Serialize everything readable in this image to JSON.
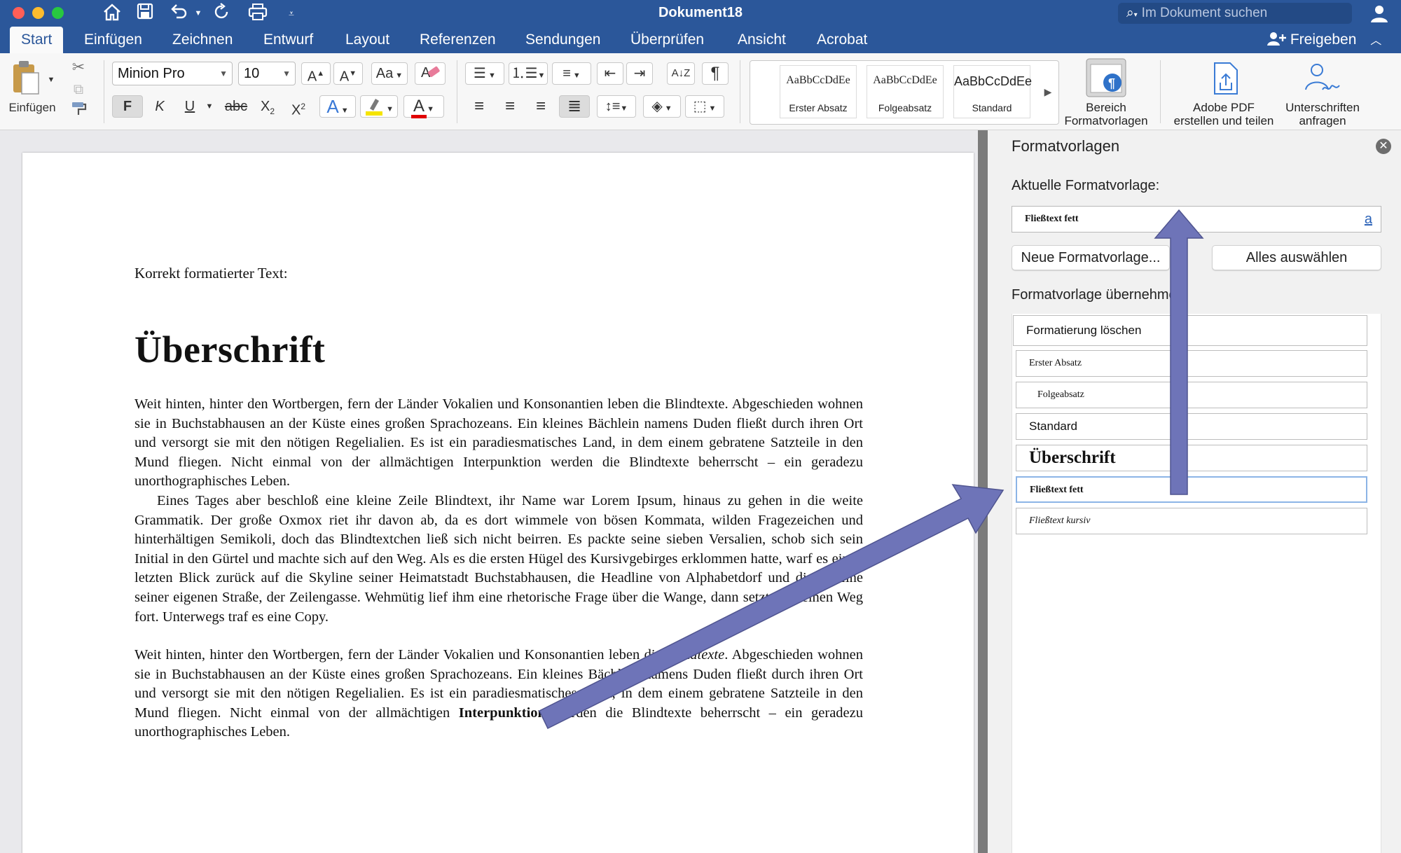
{
  "titlebar": {
    "title": "Dokument18",
    "search_placeholder": "Im Dokument suchen"
  },
  "tabs": [
    "Start",
    "Einfügen",
    "Zeichnen",
    "Entwurf",
    "Layout",
    "Referenzen",
    "Sendungen",
    "Überprüfen",
    "Ansicht",
    "Acrobat"
  ],
  "share_label": "Freigeben",
  "ribbon": {
    "paste_label": "Einfügen",
    "font_name": "Minion Pro",
    "font_size": "10",
    "bold": "F",
    "italic": "K",
    "underline": "U",
    "strike": "abc",
    "styles_gallery": [
      {
        "preview": "AaBbCcDdEe",
        "name": "Erster Absatz"
      },
      {
        "preview": "AaBbCcDdEe",
        "name": "Folgeabsatz"
      },
      {
        "preview": "AaBbCcDdEe",
        "name": "Standard"
      }
    ],
    "pane_button_label": [
      "Bereich",
      "Formatvorlagen"
    ],
    "pdf_label": [
      "Adobe PDF",
      "erstellen und teilen"
    ],
    "sign_label": [
      "Unterschriften",
      "anfragen"
    ]
  },
  "document": {
    "intro": "Korrekt formatierter Text:",
    "heading": "Überschrift",
    "para1": "Weit hinten, hinter den Wortbergen, fern der Länder Vokalien und Konsonantien leben die Blindtexte. Abgeschieden wohnen sie in Buchstabhausen an der Küste eines großen Sprachozeans. Ein kleines Bächlein namens Duden fließt durch ihren Ort und versorgt sie mit den nötigen Regelialien. Es ist ein paradiesmatisches Land, in dem einem gebratene Satzteile in den Mund fliegen. Nicht einmal von der allmächtigen Interpunktion werden die Blindtexte beherrscht – ein geradezu unorthographisches Leben.",
    "para2": "Eines Tages aber beschloß eine kleine Zeile Blindtext, ihr Name war Lorem Ipsum, hinaus zu gehen in die weite Grammatik. Der große Oxmox riet ihr davon ab, da es dort wimmele von bösen Kommata, wilden Fragezeichen und hinterhältigen Semikoli, doch das Blindtextchen ließ sich nicht beirren. Es packte seine sieben Versalien, schob sich sein Initial in den Gürtel und machte sich auf den Weg. Als es die ersten Hügel des Kursivgebirges erklommen hatte, warf es einen letzten Blick zurück auf die Skyline seiner Heimatstadt Buchstabhausen, die Headline von Alphabetdorf und die Subline seiner eigenen Straße, der Zeilengasse. Wehmütig lief ihm eine rhetorische Frage über die Wange, dann setzte es seinen Weg fort. Unterwegs traf es eine Copy.",
    "para3_a": "Weit hinten, hinter den Wortbergen, fern der Länder Vokalien und Konsonantien leben die ",
    "para3_italic": "Blindtexte",
    "para3_b": ". Abgeschieden wohnen sie in Buchstabhausen an der Küste eines großen Sprachozeans. Ein kleines Bächlein namens Duden fließt durch ihren Ort und versorgt sie mit den nötigen Regelialien. Es ist ein paradiesmatisches Land, in dem einem gebratene Satzteile in den Mund fliegen. Nicht einmal von der allmächtigen ",
    "para3_bold": "Interpunktion",
    "para3_c": " werden die Blindtexte beherrscht – ein geradezu unorthographisches Leben."
  },
  "pane": {
    "title": "Formatvorlagen",
    "current_label": "Aktuelle Formatvorlage:",
    "current_value": "Fließtext fett",
    "current_marker": "a",
    "new_style_button": "Neue Formatvorlage...",
    "select_all_button": "Alles auswählen",
    "apply_label": "Formatvorlage übernehmen:",
    "styles": [
      {
        "name": "Formatierung löschen"
      },
      {
        "name": "Erster Absatz"
      },
      {
        "name": "Folgeabsatz"
      },
      {
        "name": "Standard"
      },
      {
        "name": "Überschrift"
      },
      {
        "name": "Fließtext fett"
      },
      {
        "name": "Fließtext kursiv"
      }
    ]
  },
  "colors": {
    "word_blue": "#2b579a",
    "arrow": "#6e74b8",
    "highlight_yellow": "#f5e400",
    "font_red": "#e00000"
  }
}
